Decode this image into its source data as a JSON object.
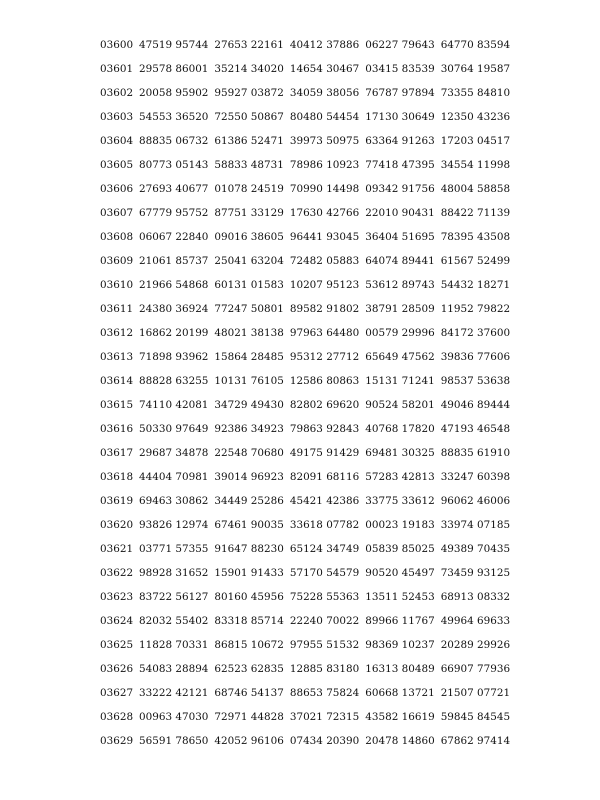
{
  "rows": [
    {
      "n": "03600",
      "g": [
        "47519 95744",
        "27653 22161",
        "40412 37886",
        "06227 79643",
        "64770 83594"
      ]
    },
    {
      "n": "03601",
      "g": [
        "29578 86001",
        "35214 34020",
        "14654 30467",
        "03415 83539",
        "30764 19587"
      ]
    },
    {
      "n": "03602",
      "g": [
        "20058 95902",
        "95927 03872",
        "34059 38056",
        "76787 97894",
        "73355 84810"
      ]
    },
    {
      "n": "03603",
      "g": [
        "54553 36520",
        "72550 50867",
        "80480 54454",
        "17130 30649",
        "12350 43236"
      ]
    },
    {
      "n": "03604",
      "g": [
        "88835 06732",
        "61386 52471",
        "39973 50975",
        "63364 91263",
        "17203 04517"
      ]
    },
    {
      "n": "03605",
      "g": [
        "80773 05143",
        "58833 48731",
        "78986 10923",
        "77418 47395",
        "34554 11998"
      ]
    },
    {
      "n": "03606",
      "g": [
        "27693 40677",
        "01078 24519",
        "70990 14498",
        "09342 91756",
        "48004 58858"
      ]
    },
    {
      "n": "03607",
      "g": [
        "67779 95752",
        "87751 33129",
        "17630 42766",
        "22010 90431",
        "88422 71139"
      ]
    },
    {
      "n": "03608",
      "g": [
        "06067 22840",
        "09016 38605",
        "96441 93045",
        "36404 51695",
        "78395 43508"
      ]
    },
    {
      "n": "03609",
      "g": [
        "21061 85737",
        "25041 63204",
        "72482 05883",
        "64074 89441",
        "61567 52499"
      ]
    },
    {
      "n": "03610",
      "g": [
        "21966 54868",
        "60131 01583",
        "10207 95123",
        "53612 89743",
        "54432 18271"
      ]
    },
    {
      "n": "03611",
      "g": [
        "24380 36924",
        "77247 50801",
        "89582 91802",
        "38791 28509",
        "11952 79822"
      ]
    },
    {
      "n": "03612",
      "g": [
        "16862 20199",
        "48021 38138",
        "97963 64480",
        "00579 29996",
        "84172 37600"
      ]
    },
    {
      "n": "03613",
      "g": [
        "71898 93962",
        "15864 28485",
        "95312 27712",
        "65649 47562",
        "39836 77606"
      ]
    },
    {
      "n": "03614",
      "g": [
        "88828 63255",
        "10131 76105",
        "12586 80863",
        "15131 71241",
        "98537 53638"
      ]
    },
    {
      "n": "03615",
      "g": [
        "74110 42081",
        "34729 49430",
        "82802 69620",
        "90524 58201",
        "49046 89444"
      ]
    },
    {
      "n": "03616",
      "g": [
        "50330 97649",
        "92386 34923",
        "79863 92843",
        "40768 17820",
        "47193 46548"
      ]
    },
    {
      "n": "03617",
      "g": [
        "29687 34878",
        "22548 70680",
        "49175 91429",
        "69481 30325",
        "88835 61910"
      ]
    },
    {
      "n": "03618",
      "g": [
        "44404 70981",
        "39014 96923",
        "82091 68116",
        "57283 42813",
        "33247 60398"
      ]
    },
    {
      "n": "03619",
      "g": [
        "69463 30862",
        "34449 25286",
        "45421 42386",
        "33775 33612",
        "96062 46006"
      ]
    },
    {
      "n": "03620",
      "g": [
        "93826 12974",
        "67461 90035",
        "33618 07782",
        "00023 19183",
        "33974 07185"
      ]
    },
    {
      "n": "03621",
      "g": [
        "03771 57355",
        "91647 88230",
        "65124 34749",
        "05839 85025",
        "49389 70435"
      ]
    },
    {
      "n": "03622",
      "g": [
        "98928 31652",
        "15901 91433",
        "57170 54579",
        "90520 45497",
        "73459 93125"
      ]
    },
    {
      "n": "03623",
      "g": [
        "83722 56127",
        "80160 45956",
        "75228 55363",
        "13511 52453",
        "68913 08332"
      ]
    },
    {
      "n": "03624",
      "g": [
        "82032 55402",
        "83318 85714",
        "22240 70022",
        "89966 11767",
        "49964 69633"
      ]
    },
    {
      "n": "03625",
      "g": [
        "11828 70331",
        "86815 10672",
        "97955 51532",
        "98369 10237",
        "20289 29926"
      ]
    },
    {
      "n": "03626",
      "g": [
        "54083 28894",
        "62523 62835",
        "12885 83180",
        "16313 80489",
        "66907 77936"
      ]
    },
    {
      "n": "03627",
      "g": [
        "33222 42121",
        "68746 54137",
        "88653 75824",
        "60668 13721",
        "21507 07721"
      ]
    },
    {
      "n": "03628",
      "g": [
        "00963 47030",
        "72971 44828",
        "37021 72315",
        "43582 16619",
        "59845 84545"
      ]
    },
    {
      "n": "03629",
      "g": [
        "56591 78650",
        "42052 96106",
        "07434 20390",
        "20478 14860",
        "67862 97414"
      ]
    }
  ]
}
